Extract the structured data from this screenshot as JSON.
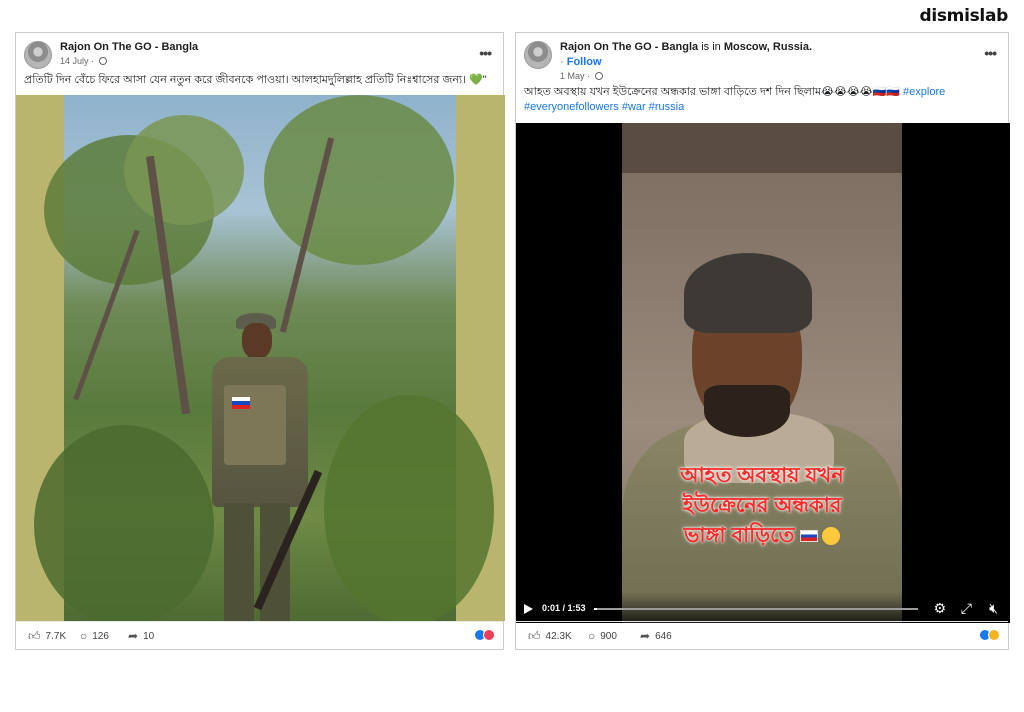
{
  "brand": "dismislab",
  "posts": [
    {
      "author": "Rajon On The GO - Bangla",
      "date": "14 July",
      "caption": "প্রতিটি দিন বেঁচে ফিরে আসা যেন নতুন করে জীবনকে পাওয়া। আলহামদুলিল্লাহ প্রতিটি নিঃশ্বাসের জন্য। 💚\"",
      "likes": "7.7K",
      "comments": "126",
      "shares": "10",
      "reaction_colors": [
        "#1877f2",
        "#f33e58"
      ]
    },
    {
      "author": "Rajon On The GO - Bangla",
      "location_prefix": "is in",
      "location": "Moscow, Russia.",
      "date": "1 May",
      "follow_label": "Follow",
      "caption": "আহত অবস্থায় যখন ইউক্রেনের অন্ধকার ভাঙ্গা বাড়িতে দশ দিন ছিলাম😭😭😭😭🇷🇺🇷🇺",
      "hashtags_line1": "#explore",
      "hashtags_line2": "#everyonefollowers #war #russia",
      "overlay_lines": [
        "আহত অবস্থায় যখন",
        "ইউক্রেনের অন্ধকার",
        "ভাঙ্গা বাড়িতে"
      ],
      "video_time": "0:01 / 1:53",
      "video_progress": 0.01,
      "likes": "42.3K",
      "comments": "900",
      "shares": "646",
      "reaction_colors": [
        "#1877f2",
        "#f7b125"
      ]
    }
  ],
  "icons": {
    "more": "more-options-icon",
    "like": "like-icon",
    "comment": "comment-icon",
    "share": "share-icon",
    "play": "play-icon",
    "settings": "gear-icon",
    "fullscreen": "fullscreen-icon",
    "volume": "volume-muted-icon"
  }
}
